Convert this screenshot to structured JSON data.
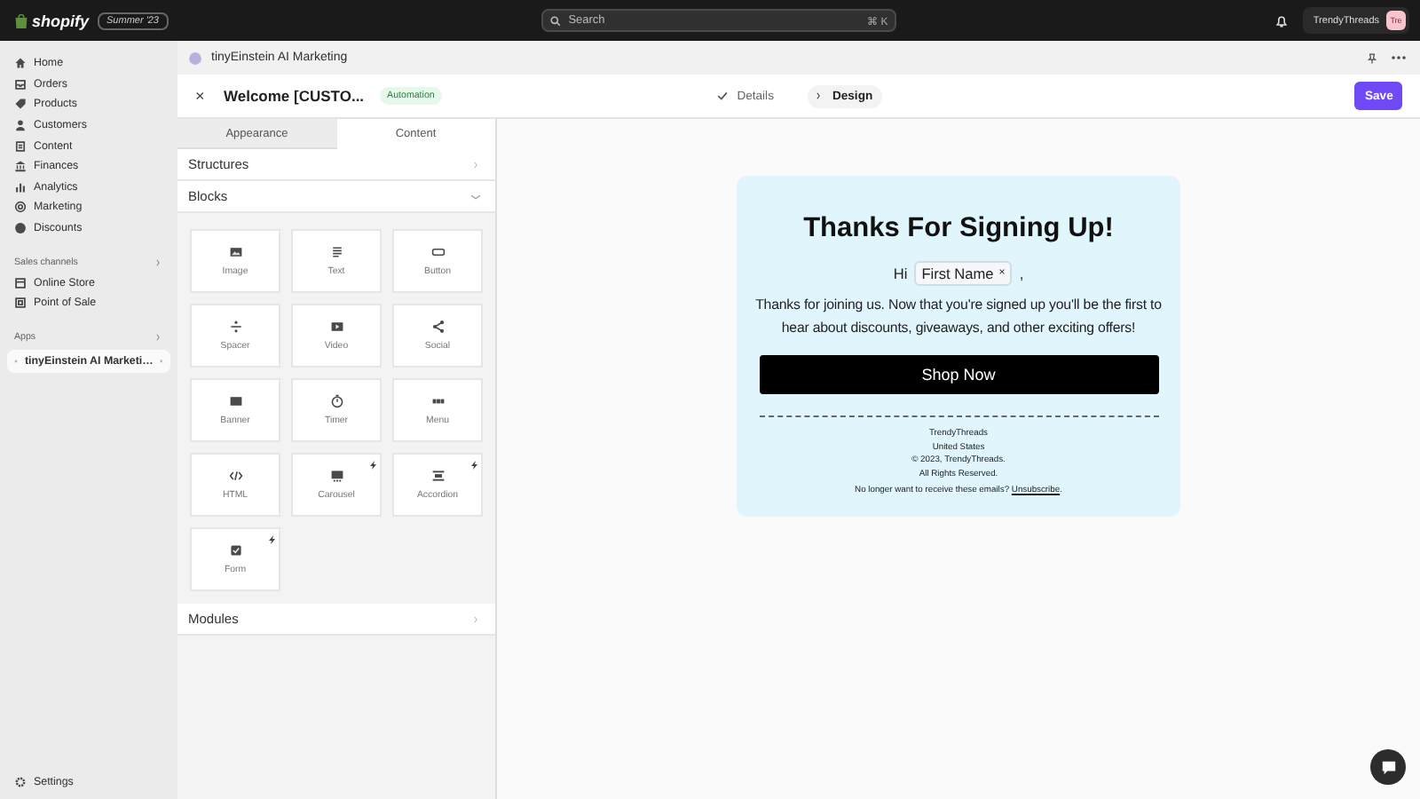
{
  "topbar": {
    "logo": "shopify",
    "badge": "Summer '23",
    "search": {
      "placeholder": "Search",
      "shortcut": "⌘ K"
    },
    "store": "TrendyThreads",
    "avatar": "Tre"
  },
  "sidebar": {
    "items": [
      {
        "label": "Home",
        "selected": false
      },
      {
        "label": "Orders",
        "selected": false
      },
      {
        "label": "Products",
        "selected": false
      },
      {
        "label": "Customers",
        "selected": false
      },
      {
        "label": "Content",
        "selected": false
      },
      {
        "label": "Finances",
        "selected": false
      },
      {
        "label": "Analytics",
        "selected": false
      },
      {
        "label": "Marketing",
        "selected": false
      },
      {
        "label": "Discounts",
        "selected": false
      }
    ],
    "sections": [
      {
        "title": "Sales channels",
        "items": [
          {
            "label": "Online Store",
            "selected": false
          },
          {
            "label": "Point of Sale",
            "selected": false
          }
        ]
      },
      {
        "title": "Apps",
        "items": [
          {
            "label": "tinyEinstein AI Marketi…",
            "selected": true
          }
        ]
      }
    ],
    "footer": "Settings"
  },
  "app_header": {
    "title": "tinyEinstein AI Marketing"
  },
  "editor_bar": {
    "close": "×",
    "title": "Welcome [CUSTO...",
    "badge": "Automation",
    "steps": [
      {
        "label": "Details",
        "done": true,
        "selected": false
      },
      {
        "label": "Design",
        "done": false,
        "selected": true
      }
    ],
    "save": "Save"
  },
  "panel": {
    "tabs": [
      {
        "label": "Appearance",
        "selected": false
      },
      {
        "label": "Content",
        "selected": true
      }
    ],
    "sections": [
      {
        "title": "Structures",
        "expanded": false
      },
      {
        "title": "Blocks",
        "expanded": true,
        "blocks": [
          {
            "label": "Image",
            "premium": false
          },
          {
            "label": "Text",
            "premium": false
          },
          {
            "label": "Button",
            "premium": false
          },
          {
            "label": "Spacer",
            "premium": false
          },
          {
            "label": "Video",
            "premium": false
          },
          {
            "label": "Social",
            "premium": false
          },
          {
            "label": "Banner",
            "premium": false
          },
          {
            "label": "Timer",
            "premium": false
          },
          {
            "label": "Menu",
            "premium": false
          },
          {
            "label": "HTML",
            "premium": false
          },
          {
            "label": "Carousel",
            "premium": true
          },
          {
            "label": "Accordion",
            "premium": true
          },
          {
            "label": "Form",
            "premium": true
          }
        ]
      },
      {
        "title": "Modules",
        "expanded": false
      }
    ]
  },
  "email": {
    "heading": "Thanks For Signing Up!",
    "greeting": "Hi",
    "merge_tag": "First Name",
    "merge_tag_remove": "×",
    "greeting_end": ",",
    "body": "Thanks for joining us. Now that you're signed up you'll be the first to hear about discounts, giveaways, and other exciting offers!",
    "button": "Shop Now",
    "footer_lines": [
      "TrendyThreads",
      "United States",
      "© 2023, TrendyThreads.",
      "All Rights Reserved."
    ],
    "unsubscribe_text": "No longer want to receive these emails?",
    "unsubscribe_link": "Unsubscribe",
    "unsubscribe_end": "."
  }
}
